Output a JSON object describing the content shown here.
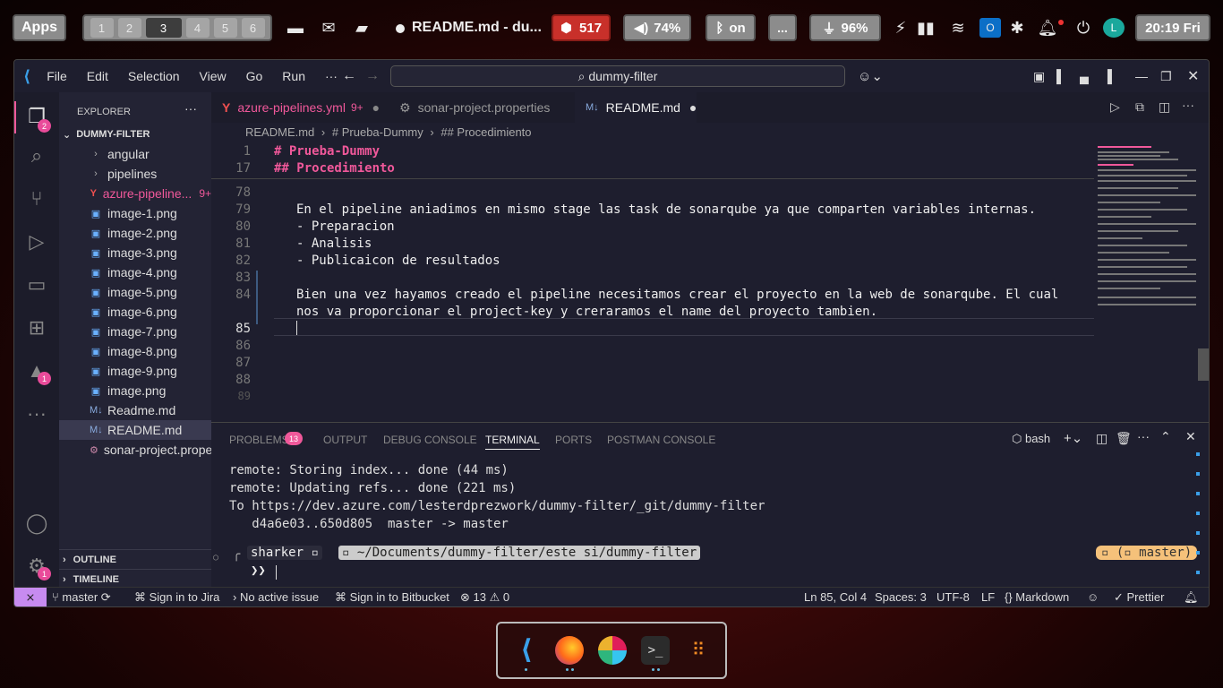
{
  "topbar": {
    "apps_label": "Apps",
    "workspaces": [
      "1",
      "2",
      "3",
      "4",
      "5",
      "6"
    ],
    "window_title": "README.md - du...",
    "docker_count": "517",
    "volume": "74%",
    "bluetooth": "on",
    "more": "...",
    "battery": "96%",
    "clock": "20:19 Fri"
  },
  "menubar": {
    "items": [
      "File",
      "Edit",
      "Selection",
      "View",
      "Go",
      "Run",
      "···"
    ],
    "command_center": "dummy-filter"
  },
  "activity": {
    "explorer_badge": "2",
    "testing_badge": "1",
    "settings_badge": "1"
  },
  "sidebar": {
    "header": "EXPLORER",
    "root": "DUMMY-FILTER",
    "items": [
      {
        "name": "angular"
      },
      {
        "name": "pipelines"
      },
      {
        "name": "azure-pipeline...",
        "badge": "9+"
      },
      {
        "name": "image-1.png"
      },
      {
        "name": "image-2.png"
      },
      {
        "name": "image-3.png"
      },
      {
        "name": "image-4.png"
      },
      {
        "name": "image-5.png"
      },
      {
        "name": "image-6.png"
      },
      {
        "name": "image-7.png"
      },
      {
        "name": "image-8.png"
      },
      {
        "name": "image-9.png"
      },
      {
        "name": "image.png"
      },
      {
        "name": "Readme.md"
      },
      {
        "name": "README.md"
      },
      {
        "name": "sonar-project.prope..."
      }
    ],
    "outline": "OUTLINE",
    "timeline": "TIMELINE"
  },
  "tabs": [
    {
      "label": "azure-pipelines.yml",
      "badge": "9+"
    },
    {
      "label": "sonar-project.properties"
    },
    {
      "label": "README.md"
    }
  ],
  "breadcrumb": {
    "file": "README.md",
    "h1": "# Prueba-Dummy",
    "h2": "## Procedimiento"
  },
  "editor": {
    "sticky": [
      {
        "num": "1",
        "text": "# Prueba-Dummy"
      },
      {
        "num": "17",
        "text": "## Procedimiento"
      }
    ],
    "lines": [
      {
        "num": "78",
        "text": ""
      },
      {
        "num": "79",
        "text": "En el pipeline aniadimos en mismo stage las task de sonarqube ya que comparten variables internas."
      },
      {
        "num": "80",
        "text": "- Preparacion"
      },
      {
        "num": "81",
        "text": "- Analisis"
      },
      {
        "num": "82",
        "text": "- Publicaicon de resultados"
      },
      {
        "num": "83",
        "text": ""
      },
      {
        "num": "84",
        "text": "Bien una vez hayamos creado el pipeline necesitamos crear el proyecto en la web de sonarqube. El cual"
      },
      {
        "num": "",
        "text": "nos va proporcionar el project-key y creraramos el name del proyecto tambien."
      },
      {
        "num": "85",
        "text": ""
      },
      {
        "num": "86",
        "text": ""
      },
      {
        "num": "87",
        "text": ""
      },
      {
        "num": "88",
        "text": ""
      },
      {
        "num": "89",
        "text": ""
      }
    ]
  },
  "panel": {
    "tabs": [
      "PROBLEMS",
      "OUTPUT",
      "DEBUG CONSOLE",
      "TERMINAL",
      "PORTS",
      "POSTMAN CONSOLE"
    ],
    "problems_count": "13",
    "shell": "bash"
  },
  "terminal": {
    "lines": [
      "remote: Storing index... done (44 ms)",
      "remote: Updating refs... done (221 ms)",
      "To https://dev.azure.com/lesterdprezwork/dummy-filter/_git/dummy-filter",
      "   d4a6e03..650d805  master -> master"
    ],
    "prompt_user": "sharker",
    "prompt_path": "~/Documents/dummy-filter/este si/dummy-filter",
    "prompt_branch": "master",
    "prompt_char": "❯❯"
  },
  "status": {
    "branch": "master",
    "jira": "Sign in to Jira",
    "issue": "No active issue",
    "bitbucket": "Sign in to Bitbucket",
    "errors": "13",
    "warnings": "0",
    "position": "Ln 85, Col 4",
    "spaces": "Spaces: 3",
    "encoding": "UTF-8",
    "eol": "LF",
    "language": "Markdown",
    "prettier": "Prettier"
  }
}
